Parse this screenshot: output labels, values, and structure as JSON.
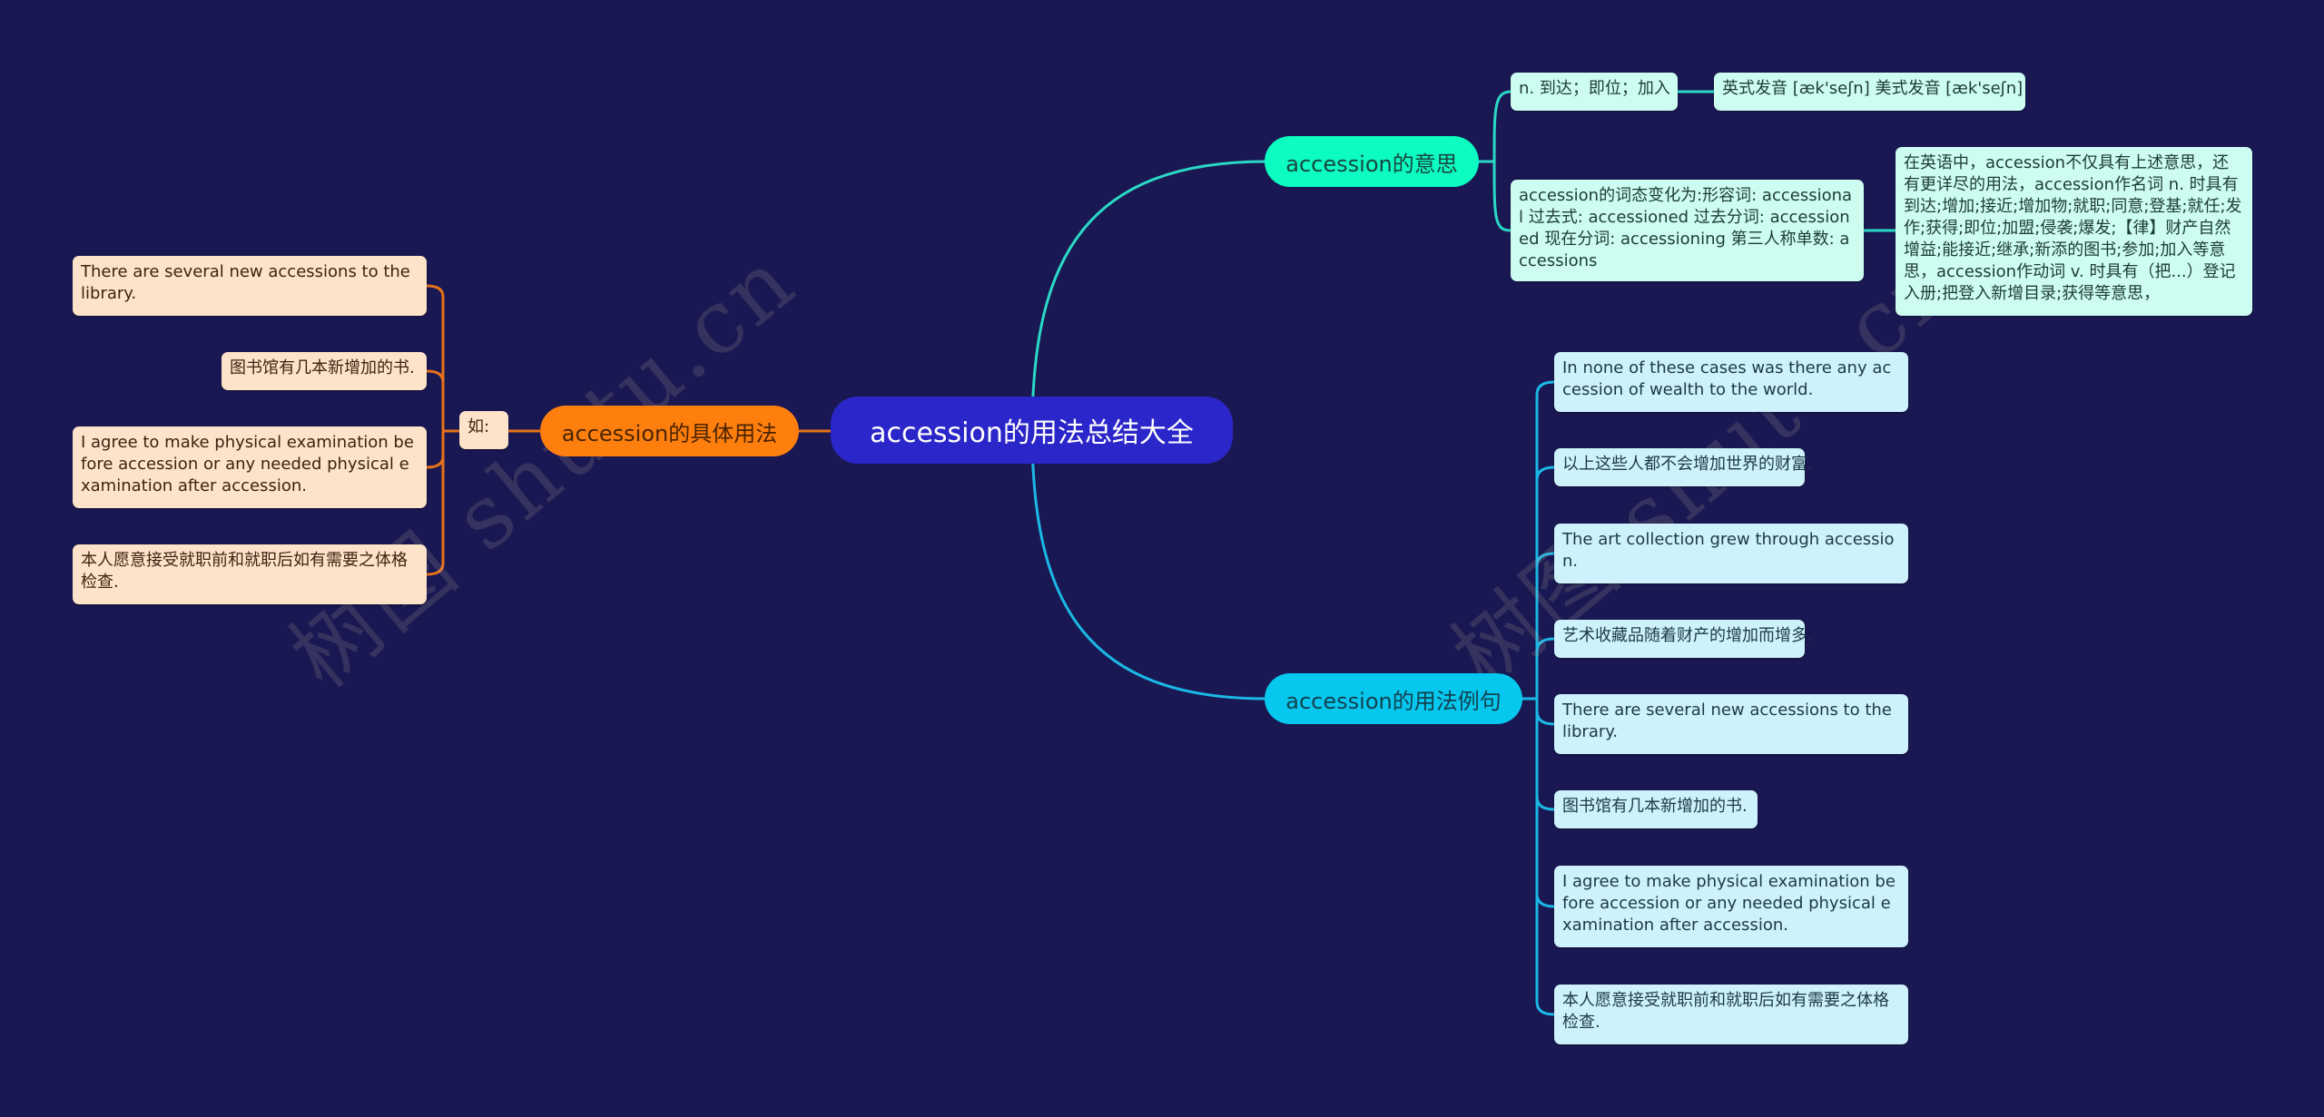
{
  "watermark": "树图 shutu.cn",
  "colors": {
    "background": "#1a1852",
    "root": "#2a26c9",
    "meaning_branch": "#0dfcc2",
    "examples_branch": "#06c8ee",
    "usage_branch": "#ff7f0e",
    "meaning_line": "#2ad9c6",
    "examples_line": "#1ab8e6",
    "usage_line": "#e6721a"
  },
  "root": {
    "label": "accession的用法总结大全"
  },
  "branches": {
    "meaning": {
      "label": "accession的意思",
      "children": [
        {
          "text": "n. 到达；即位；加入",
          "child": "英式发音 [æk'seʃn] 美式发音 [æk'seʃn]"
        },
        {
          "text": "accession的词态变化为:形容词: accessional 过去式: accessioned 过去分词: accessioned 现在分词: accessioning 第三人称单数: accessions",
          "child": "在英语中，accession不仅具有上述意思，还有更详尽的用法，accession作名词 n. 时具有到达;增加;接近;增加物;就职;同意;登基;就任;发作;获得;即位;加盟;侵袭;爆发;【律】财产自然增益;能接近;继承;新添的图书;参加;加入等意思，accession作动词 v. 时具有（把...）登记入册;把登入新增目录;获得等意思，"
        }
      ]
    },
    "examples": {
      "label": "accession的用法例句",
      "children": [
        "In none of these cases was there any accession of wealth to the world.",
        "以上这些人都不会增加世界的财富.",
        "The art collection grew through accession.",
        "艺术收藏品随着财产的增加而增多.",
        "There are several new accessions to the library.",
        "图书馆有几本新增加的书.",
        "I agree to make physical examination before accession or any needed physical examination after accession.",
        "本人愿意接受就职前和就职后如有需要之体格检查."
      ]
    },
    "usage": {
      "label": "accession的具体用法",
      "connector": "如:",
      "children": [
        "There are several new accessions to the library.",
        "图书馆有几本新增加的书.",
        "I agree to make physical examination before accession or any needed physical examination after accession.",
        "本人愿意接受就职前和就职后如有需要之体格检查."
      ]
    }
  }
}
